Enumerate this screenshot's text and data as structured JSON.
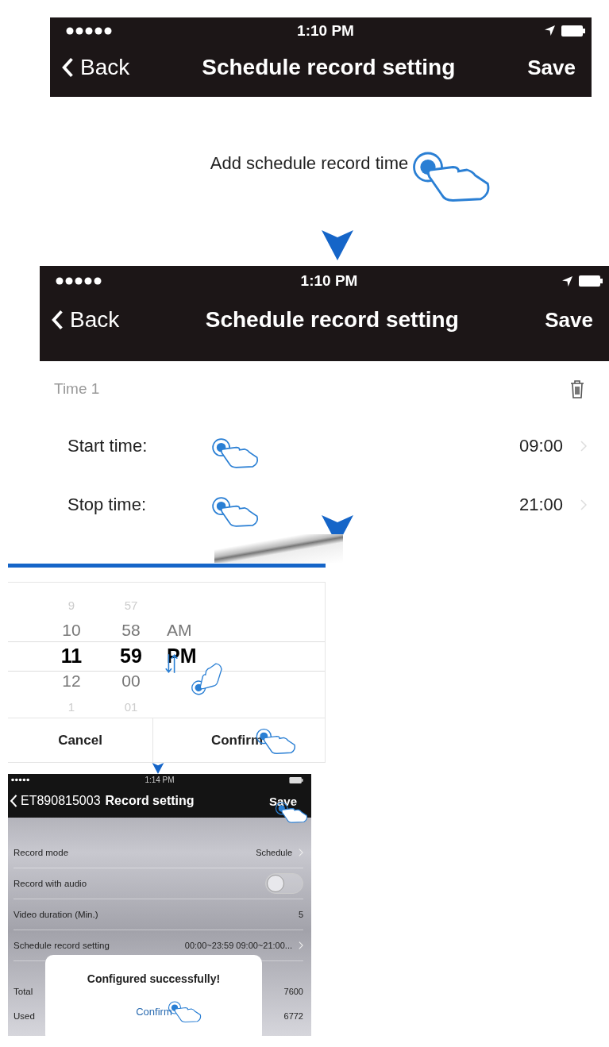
{
  "add_screen": {
    "status_time": "1:10 PM",
    "back": "Back",
    "title": "Schedule record setting",
    "save": "Save",
    "add_label": "Add schedule record time"
  },
  "time_screen": {
    "status_time": "1:10 PM",
    "back": "Back",
    "title": "Schedule record setting",
    "save": "Save",
    "section_title": "Time 1",
    "rows": [
      {
        "label": "Start time:",
        "value": "09:00"
      },
      {
        "label": "Stop time:",
        "value": "21:00"
      }
    ]
  },
  "picker": {
    "columns": [
      {
        "items": [
          {
            "text": "9",
            "selected": false
          },
          {
            "text": "10",
            "selected": false
          },
          {
            "text": "11",
            "selected": true
          },
          {
            "text": "12",
            "selected": false
          },
          {
            "text": "1",
            "selected": false
          }
        ]
      },
      {
        "items": [
          {
            "text": "57",
            "selected": false
          },
          {
            "text": "58",
            "selected": false
          },
          {
            "text": "59",
            "selected": true
          },
          {
            "text": "00",
            "selected": false
          },
          {
            "text": "01",
            "selected": false
          }
        ]
      },
      {
        "items": [
          {
            "text": "AM",
            "selected": false
          },
          {
            "text": "PM",
            "selected": true
          }
        ]
      }
    ],
    "cancel": "Cancel",
    "confirm": "Confirm"
  },
  "record_screen": {
    "status_time": "1:14 PM",
    "back": "ET890815003",
    "title": "Record setting",
    "save": "Save",
    "rows": [
      {
        "kind": "chevron",
        "label": "Record mode",
        "value": "Schedule"
      },
      {
        "kind": "toggle",
        "label": "Record with audio",
        "on": false
      },
      {
        "kind": "value",
        "label": "Video duration (Min.)",
        "value": "5"
      },
      {
        "kind": "chevron",
        "label": "Schedule record setting",
        "value": "00:00~23:59 09:00~21:00..."
      },
      {
        "kind": "value",
        "label": "Total",
        "value": "7600"
      },
      {
        "kind": "value",
        "label": "Used",
        "value": "6772"
      }
    ],
    "dialog": {
      "message": "Configured successfully!",
      "button": "Confirm"
    }
  }
}
